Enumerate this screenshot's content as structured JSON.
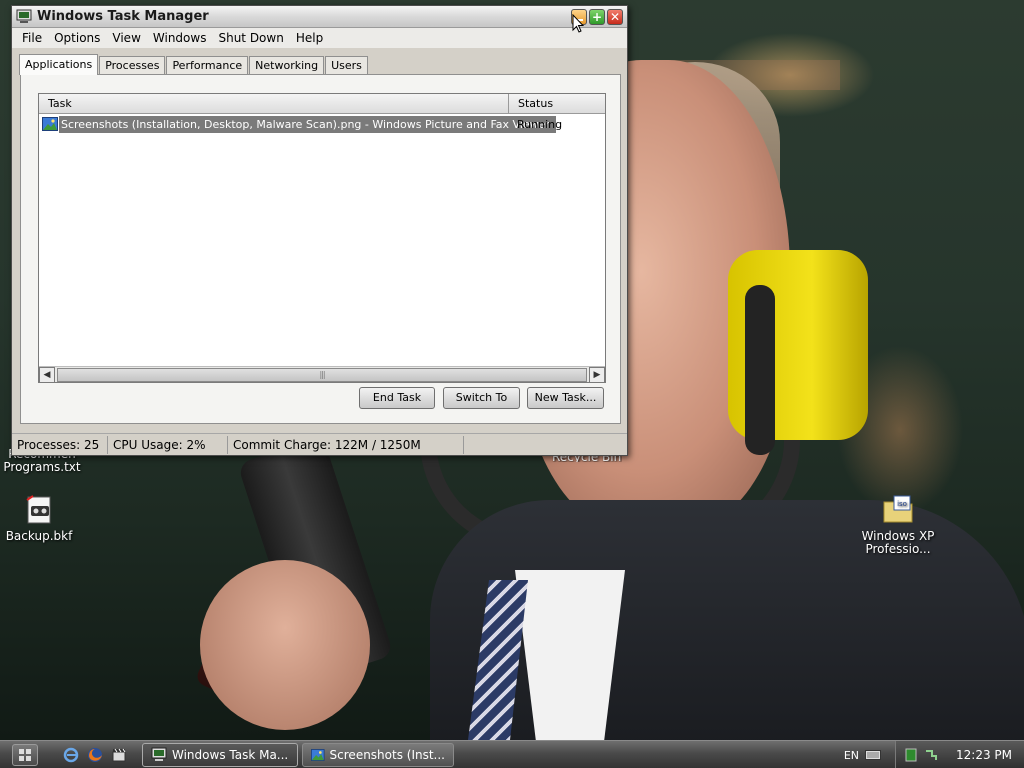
{
  "window": {
    "title": "Windows Task Manager",
    "menu": [
      "File",
      "Options",
      "View",
      "Windows",
      "Shut Down",
      "Help"
    ],
    "tabs": [
      "Applications",
      "Processes",
      "Performance",
      "Networking",
      "Users"
    ],
    "active_tab": "Applications",
    "table": {
      "columns": [
        "Task",
        "Status"
      ],
      "rows": [
        {
          "task": "Screenshots (Installation, Desktop, Malware Scan).png - Windows Picture and Fax Viewer",
          "status": "Running"
        }
      ]
    },
    "buttons": {
      "end_task": "End Task",
      "switch_to": "Switch To",
      "new_task": "New Task..."
    },
    "status": {
      "processes": "Processes: 25",
      "cpu": "CPU Usage: 2%",
      "commit": "Commit Charge: 122M / 1250M"
    }
  },
  "desktop": {
    "icons": [
      {
        "label": "Backup.bkf",
        "icon": "backup-file-icon"
      },
      {
        "label": "Windows XP Professio...",
        "icon": "iso-file-icon"
      }
    ],
    "partial_labels": {
      "recommended_line1": "Recommen",
      "recommended_line2": "Programs.txt",
      "recycle_bin": "Recycle Bin"
    }
  },
  "taskbar": {
    "buttons": [
      {
        "label": "Windows Task Ma...",
        "icon": "task-manager-icon",
        "active": true
      },
      {
        "label": "Screenshots (Inst...",
        "icon": "picture-viewer-icon",
        "active": false
      }
    ],
    "language": "EN",
    "clock": "12:23 PM"
  },
  "colors": {
    "window_face": "#d4d0c8",
    "selection": "#7a7a7a",
    "taskbar": "#4a4a4a"
  }
}
